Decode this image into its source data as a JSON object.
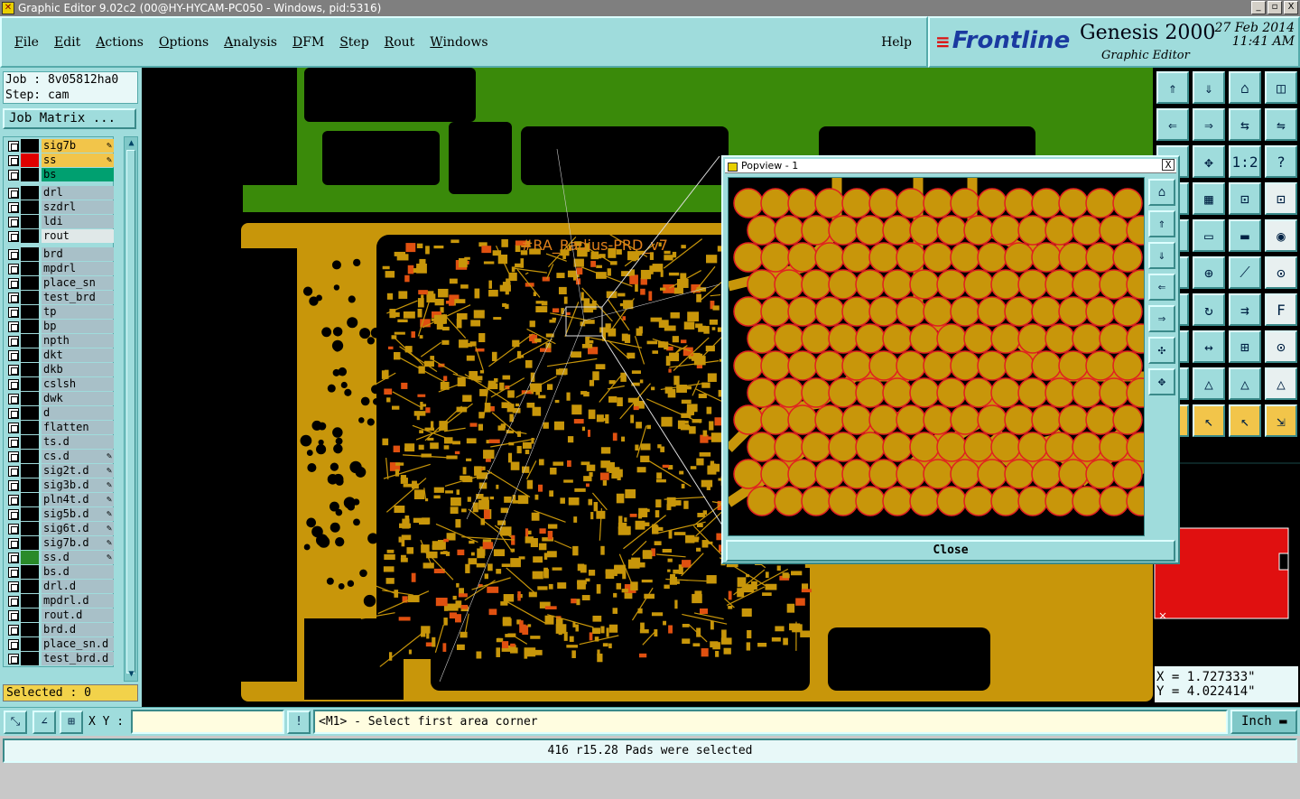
{
  "window": {
    "title": "Graphic Editor 9.02c2 (00@HY-HYCAM-PC050 - Windows, pid:5316)",
    "buttons": [
      "_",
      "▫",
      "X"
    ]
  },
  "menu": {
    "items": [
      "File",
      "Edit",
      "Actions",
      "Options",
      "Analysis",
      "DFM",
      "Step",
      "Rout",
      "Windows"
    ],
    "help": "Help"
  },
  "brand": {
    "logo": "Frontline",
    "product": "Genesis 2000",
    "subtitle": "Graphic Editor",
    "date": "27 Feb 2014",
    "time": "11:41 AM"
  },
  "job": {
    "job_line": "Job : 8v05812ha0",
    "step_line": "Step: cam",
    "matrix_button": "Job Matrix ..."
  },
  "layers": [
    {
      "name": "sig7b",
      "bg": "#f2c54a",
      "swatch": "#000000",
      "editable": true
    },
    {
      "name": "ss",
      "bg": "#f2c54a",
      "swatch": "#e00000",
      "editable": true,
      "work": true
    },
    {
      "name": "bs",
      "bg": "#00a070",
      "swatch": "#000000",
      "editable": false
    },
    {
      "name": "drl",
      "bg": "#a8c0c8",
      "swatch": "",
      "editable": false
    },
    {
      "name": "szdrl",
      "bg": "#a8c0c8",
      "swatch": "",
      "editable": false
    },
    {
      "name": "ldi",
      "bg": "#a8c0c8",
      "swatch": "",
      "editable": false
    },
    {
      "name": "rout",
      "bg": "#e0e8e8",
      "swatch": "",
      "editable": false
    },
    {
      "name": "brd",
      "bg": "#a8c0c8",
      "swatch": "",
      "editable": false
    },
    {
      "name": "mpdrl",
      "bg": "#a8c0c8",
      "swatch": "",
      "editable": false
    },
    {
      "name": "place_sn",
      "bg": "#a8c0c8",
      "swatch": "",
      "editable": false
    },
    {
      "name": "test_brd",
      "bg": "#a8c0c8",
      "swatch": "",
      "editable": false
    },
    {
      "name": "tp",
      "bg": "#a8c0c8",
      "swatch": "",
      "editable": false
    },
    {
      "name": "bp",
      "bg": "#a8c0c8",
      "swatch": "",
      "editable": false
    },
    {
      "name": "npth",
      "bg": "#a8c0c8",
      "swatch": "",
      "editable": false
    },
    {
      "name": "dkt",
      "bg": "#a8c0c8",
      "swatch": "",
      "editable": false
    },
    {
      "name": "dkb",
      "bg": "#a8c0c8",
      "swatch": "",
      "editable": false
    },
    {
      "name": "cslsh",
      "bg": "#a8c0c8",
      "swatch": "",
      "editable": false
    },
    {
      "name": "dwk",
      "bg": "#a8c0c8",
      "swatch": "",
      "editable": false
    },
    {
      "name": "d",
      "bg": "#a8c0c8",
      "swatch": "",
      "editable": false
    },
    {
      "name": "flatten",
      "bg": "#a8c0c8",
      "swatch": "",
      "editable": false
    },
    {
      "name": "ts.d",
      "bg": "#a8c0c8",
      "swatch": "",
      "editable": false
    },
    {
      "name": "cs.d",
      "bg": "#a8c0c8",
      "swatch": "",
      "editable": true
    },
    {
      "name": "sig2t.d",
      "bg": "#a8c0c8",
      "swatch": "",
      "editable": true
    },
    {
      "name": "sig3b.d",
      "bg": "#a8c0c8",
      "swatch": "",
      "editable": true
    },
    {
      "name": "pln4t.d",
      "bg": "#a8c0c8",
      "swatch": "",
      "editable": true
    },
    {
      "name": "sig5b.d",
      "bg": "#a8c0c8",
      "swatch": "",
      "editable": true
    },
    {
      "name": "sig6t.d",
      "bg": "#a8c0c8",
      "swatch": "",
      "editable": true
    },
    {
      "name": "sig7b.d",
      "bg": "#a8c0c8",
      "swatch": "",
      "editable": true
    },
    {
      "name": "ss.d",
      "bg": "#a8c0c8",
      "swatch": "#2a8a2a",
      "editable": true
    },
    {
      "name": "bs.d",
      "bg": "#a8c0c8",
      "swatch": "",
      "editable": false
    },
    {
      "name": "drl.d",
      "bg": "#a8c0c8",
      "swatch": "",
      "editable": false
    },
    {
      "name": "mpdrl.d",
      "bg": "#a8c0c8",
      "swatch": "",
      "editable": false
    },
    {
      "name": "rout.d",
      "bg": "#a8c0c8",
      "swatch": "",
      "editable": false
    },
    {
      "name": "brd.d",
      "bg": "#a8c0c8",
      "swatch": "",
      "editable": false
    },
    {
      "name": "place_sn.d",
      "bg": "#a8c0c8",
      "swatch": "",
      "editable": false
    },
    {
      "name": "test_brd.d",
      "bg": "#a8c0c8",
      "swatch": "",
      "editable": false
    }
  ],
  "selected": "Selected : 0",
  "board_text": "#RA_Radius-PRD_v7",
  "popview": {
    "title": "Popview - 1",
    "close_label": "Close",
    "close_glyph": "X"
  },
  "coords": {
    "x": "X = 1.727333\"",
    "y": "Y = 4.022414\""
  },
  "command": {
    "xy_label": "X Y :",
    "xy_value": "",
    "prompt": "<M1> - Select first area corner",
    "unit": "Inch"
  },
  "status": "416 r15.28 Pads were selected",
  "colors": {
    "copper": "#c8960a",
    "green_layer": "#3a8a0a",
    "pad_outline": "#e02020",
    "panel": "#9fdcdc"
  }
}
